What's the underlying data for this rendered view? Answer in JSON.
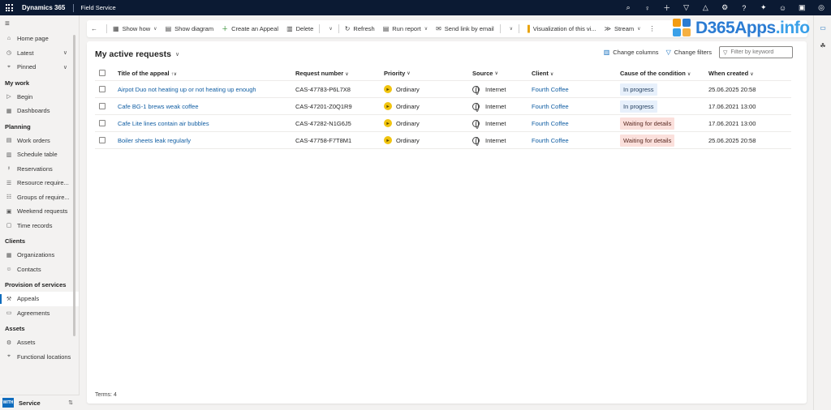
{
  "topbar": {
    "app_name": "Dynamics 365",
    "module": "Field Service",
    "icons": [
      "search-icon",
      "lightbulb-icon",
      "plus-icon",
      "filter-icon",
      "bell-icon",
      "settings-icon",
      "help-icon",
      "copilot-icon",
      "feedback-icon",
      "teams-icon",
      "user-icon"
    ]
  },
  "watermark": {
    "text_main": "D365Apps",
    "text_domain": ".info"
  },
  "sidebar": {
    "home": "Home page",
    "recent": "Latest",
    "pinned": "Pinned",
    "groups": [
      {
        "title": "My work",
        "items": [
          {
            "label": "Begin",
            "icon": "play-icon"
          },
          {
            "label": "Dashboards",
            "icon": "dashboard-icon"
          }
        ]
      },
      {
        "title": "Planning",
        "items": [
          {
            "label": "Work orders",
            "icon": "clipboard-icon"
          },
          {
            "label": "Schedule table",
            "icon": "calendar-icon"
          },
          {
            "label": "Reservations",
            "icon": "person-clock-icon"
          },
          {
            "label": "Resource require...",
            "icon": "list-icon"
          },
          {
            "label": "Groups of require...",
            "icon": "group-list-icon"
          },
          {
            "label": "Weekend requests",
            "icon": "calendar-week-icon"
          },
          {
            "label": "Time records",
            "icon": "calendar-time-icon"
          }
        ]
      },
      {
        "title": "Clients",
        "items": [
          {
            "label": "Organizations",
            "icon": "building-icon"
          },
          {
            "label": "Contacts",
            "icon": "person-icon"
          }
        ]
      },
      {
        "title": "Provision of services",
        "items": [
          {
            "label": "Appeals",
            "icon": "wrench-icon",
            "active": true
          },
          {
            "label": "Agreements",
            "icon": "document-icon"
          }
        ]
      },
      {
        "title": "Assets",
        "items": [
          {
            "label": "Assets",
            "icon": "gear-icon"
          },
          {
            "label": "Functional locations",
            "icon": "location-icon"
          }
        ]
      }
    ],
    "area": {
      "badge": "WITH",
      "label": "Service"
    }
  },
  "commandbar": {
    "show_how": "Show how",
    "show_diagram": "Show diagram",
    "create": "Create an Appeal",
    "delete": "Delete",
    "refresh": "Refresh",
    "run_report": "Run report",
    "send_link": "Send link by email",
    "visualization": "Visualization of this vi...",
    "stream": "Stream"
  },
  "view": {
    "title": "My active requests",
    "change_columns": "Change columns",
    "change_filters": "Change filters",
    "filter_placeholder": "Filter by keyword",
    "columns": [
      "Title of the appeal",
      "Request number",
      "Priority",
      "Source",
      "Client",
      "Cause of the condition",
      "When created"
    ],
    "rows": [
      {
        "title": "Airpot Duo not heating up or not heating up enough",
        "number": "CAS-47783-P6L7X8",
        "priority": "Ordinary",
        "source": "Internet",
        "client": "Fourth Coffee",
        "status": "In progress",
        "status_kind": "progress",
        "created": "25.06.2025 20:58"
      },
      {
        "title": "Cafe BG-1 brews weak coffee",
        "number": "CAS-47201-Z0Q1R9",
        "priority": "Ordinary",
        "source": "Internet",
        "client": "Fourth Coffee",
        "status": "In progress",
        "status_kind": "progress",
        "created": "17.06.2021 13:00"
      },
      {
        "title": "Cafe Lite lines contain air bubbles",
        "number": "CAS-47282-N1G6J5",
        "priority": "Ordinary",
        "source": "Internet",
        "client": "Fourth Coffee",
        "status": "Waiting for details",
        "status_kind": "waiting",
        "created": "17.06.2021 13:00"
      },
      {
        "title": "Boiler sheets leak regularly",
        "number": "CAS-47758-F7T8M1",
        "priority": "Ordinary",
        "source": "Internet",
        "client": "Fourth Coffee",
        "status": "Waiting for details",
        "status_kind": "waiting",
        "created": "25.06.2025 20:58"
      }
    ],
    "total": "Terms: 4"
  }
}
